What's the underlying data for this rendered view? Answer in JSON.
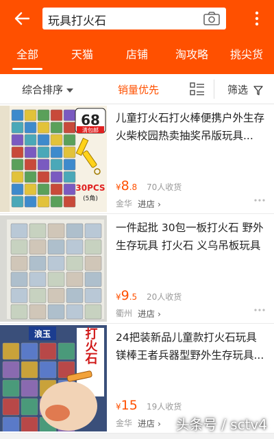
{
  "header": {
    "back_icon": "arrow-left-icon",
    "search_query": "玩具打火石",
    "camera_icon": "camera-icon",
    "more_icon": "more-vertical-icon",
    "tabs": [
      {
        "label": "全部",
        "active": true
      },
      {
        "label": "天猫",
        "active": false
      },
      {
        "label": "店铺",
        "active": false
      },
      {
        "label": "淘攻略",
        "active": false
      },
      {
        "label": "挑尖货",
        "active": false
      }
    ]
  },
  "sort": {
    "default_label": "综合排序",
    "sales_label": "销量优先",
    "filter_label": "筛选",
    "view_icon": "list-view-icon",
    "filter_icon": "funnel-icon"
  },
  "products": [
    {
      "title": "儿童打火石打火棒便携户外生存火柴校园热卖抽奖吊版玩具...",
      "price_int": "8",
      "price_dec": ".8",
      "sold": "70人收货",
      "location": "金华",
      "shop_link": "进店 ›",
      "image_text": [
        "68",
        "清包邮",
        "30PCS",
        "(5角)"
      ]
    },
    {
      "title": "一件起批 30包一板打火石 野外生存玩具 打火石 义乌吊板玩具",
      "price_int": "9",
      "price_dec": ".5",
      "sold": "20人收货",
      "location": "衢州",
      "shop_link": "进店 ›",
      "image_text": []
    },
    {
      "title": "24把装新品儿童款打火石玩具镁棒王者兵器型野外生存玩具...",
      "price_int": "15",
      "price_dec": "",
      "sold": "19人收货",
      "location": "金华",
      "shop_link": "进店 ›",
      "image_text": [
        "打火石",
        "浪玉"
      ]
    }
  ],
  "watermark": "头条号 / sctv4",
  "colors": {
    "brand": "#ff5000",
    "text": "#222222",
    "muted": "#999999"
  }
}
